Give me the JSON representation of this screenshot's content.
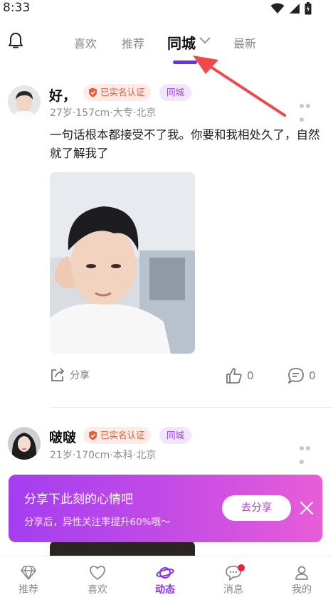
{
  "status_bar": {
    "time": "8:33"
  },
  "top_nav": {
    "tabs": [
      {
        "label": "喜欢"
      },
      {
        "label": "推荐"
      },
      {
        "label": "同城"
      },
      {
        "label": "最新"
      }
    ],
    "active_index": 2,
    "accent_color": "#6b2df0"
  },
  "posts": [
    {
      "username": "好，",
      "verified_badge": "已实名认证",
      "city_badge": "同城",
      "meta": "27岁·157cm·大专·北京",
      "text": "一句话根本都接受不了我。你要和我相处久了，自然就了解我了",
      "share_label": "分享",
      "likes": "0",
      "comments": "0"
    },
    {
      "username": "啵啵",
      "verified_badge": "已实名认证",
      "city_badge": "同城",
      "meta": "21岁·170cm·本科·北京"
    }
  ],
  "share_banner": {
    "title": "分享下此刻的心情吧",
    "subtitle": "分享后，异性关注率提升60%哦～",
    "button": "去分享"
  },
  "bottom_nav": {
    "items": [
      {
        "label": "推荐",
        "icon": "diamond-icon"
      },
      {
        "label": "喜欢",
        "icon": "heart-icon"
      },
      {
        "label": "动态",
        "icon": "planet-icon"
      },
      {
        "label": "消息",
        "icon": "chat-icon"
      },
      {
        "label": "我的",
        "icon": "profile-icon"
      }
    ],
    "active_index": 2
  }
}
